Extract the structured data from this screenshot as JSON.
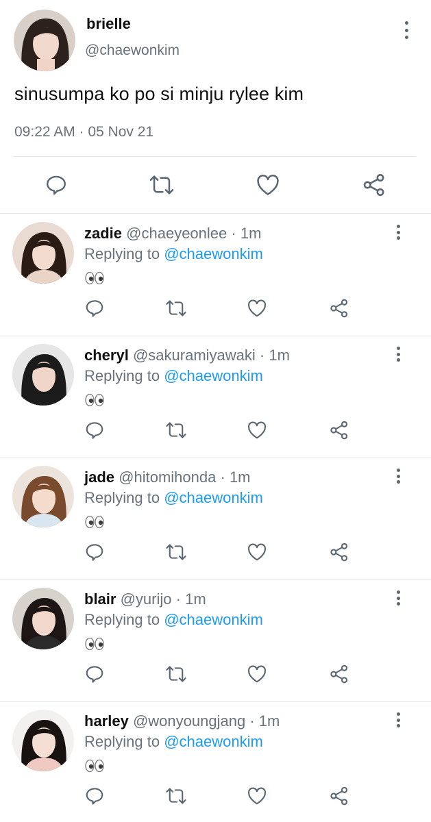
{
  "tweet": {
    "name": "brielle",
    "handle": "@chaewonkim",
    "text": "sinusumpa ko po si minju rylee kim",
    "timestamp": "09:22 AM · 05 Nov 21"
  },
  "replies": [
    {
      "name": "zadie",
      "handle": "@chaeyeonlee",
      "age": "1m",
      "replying_label": "Replying to",
      "mention": "@chaewonkim",
      "text": "👀"
    },
    {
      "name": "cheryl",
      "handle": "@sakuramiyawaki",
      "age": "1m",
      "replying_label": "Replying to",
      "mention": "@chaewonkim",
      "text": "👀"
    },
    {
      "name": "jade",
      "handle": "@hitomihonda",
      "age": "1m",
      "replying_label": "Replying to",
      "mention": "@chaewonkim",
      "text": "👀"
    },
    {
      "name": "blair",
      "handle": "@yurijo",
      "age": "1m",
      "replying_label": "Replying to",
      "mention": "@chaewonkim",
      "text": "👀"
    },
    {
      "name": "harley",
      "handle": "@wonyoungjang",
      "age": "1m",
      "replying_label": "Replying to",
      "mention": "@chaewonkim",
      "text": "👀"
    }
  ],
  "icons": [
    "reply-icon",
    "retweet-icon",
    "like-icon",
    "share-icon",
    "more-options-icon"
  ],
  "colors": {
    "link": "#1d9bf0",
    "secondary_text": "#68727b",
    "icon": "#5b6670",
    "divider": "#e1e4e8"
  }
}
